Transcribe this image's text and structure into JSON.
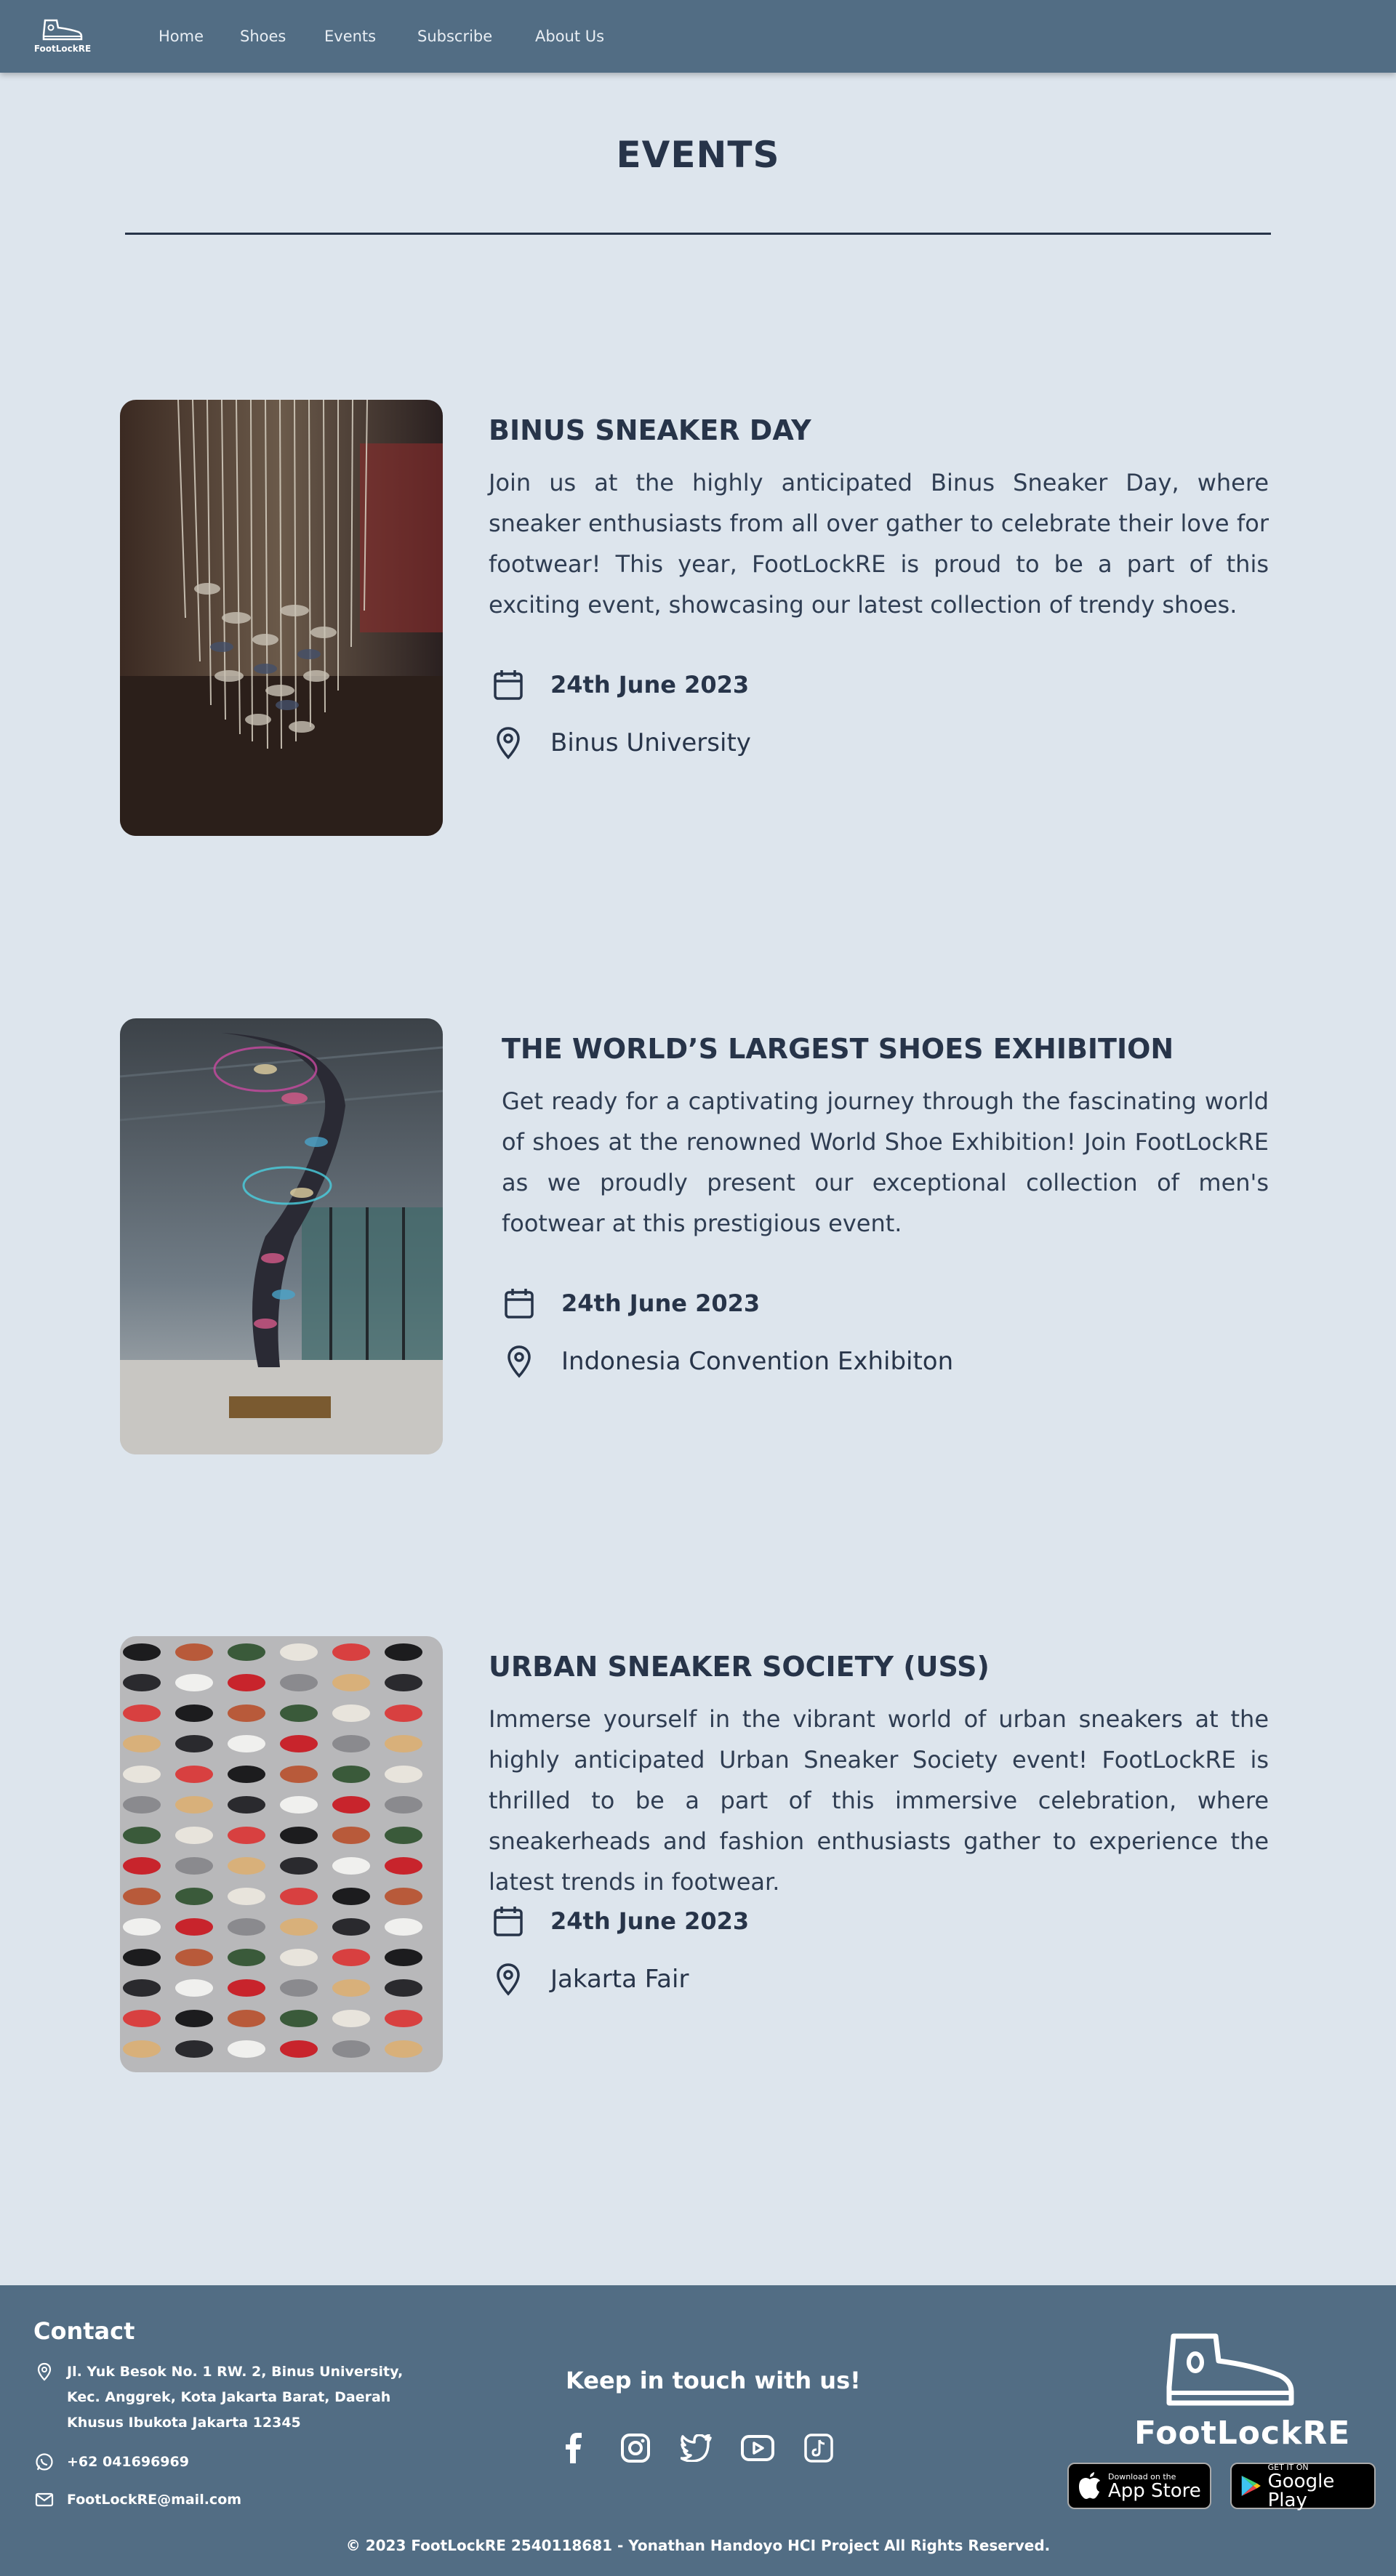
{
  "nav": {
    "logo_text": "FootLockRE",
    "links": [
      "Home",
      "Shoes",
      "Events",
      "Subscribe",
      "About Us"
    ]
  },
  "page": {
    "title": "EVENTS"
  },
  "events": [
    {
      "title": "BINUS SNEAKER DAY",
      "description": "Join us at the highly anticipated Binus Sneaker Day, where sneaker enthusiasts from all over gather to celebrate their love for footwear! This year, FootLockRE is proud to be a part of this exciting event, showcasing our latest collection of trendy shoes.",
      "date": "24th June 2023",
      "location": "Binus University"
    },
    {
      "title": "THE WORLD’S LARGEST SHOES EXHIBITION",
      "description": "Get ready for a captivating journey through the fascinating world of shoes at the renowned World Shoe Exhibition! Join FootLockRE as we proudly present our exceptional collection of men's footwear at this prestigious event.",
      "date": "24th June 2023",
      "location": "Indonesia Convention Exhibiton"
    },
    {
      "title": "URBAN SNEAKER SOCIETY (USS)",
      "description": "Immerse yourself in the vibrant world of urban sneakers at the highly anticipated Urban Sneaker Society event! FootLockRE is thrilled to be a part of this immersive celebration, where sneakerheads and fashion enthusiasts gather to experience the latest trends in footwear.",
      "date": "24th June 2023",
      "location": "Jakarta Fair"
    }
  ],
  "footer": {
    "contact_title": "Contact",
    "address_lines": [
      "Jl. Yuk Besok No. 1 RW. 2, Binus University,",
      "Kec. Anggrek, Kota Jakarta Barat, Daerah",
      "Khusus Ibukota Jakarta 12345"
    ],
    "phone": "+62 041696969",
    "email": "FootLockRE@mail.com",
    "keep_in_touch": "Keep in touch with us!",
    "social_icons": [
      "facebook-icon",
      "instagram-icon",
      "twitter-icon",
      "youtube-icon",
      "tiktok-icon"
    ],
    "brand_text": "FootLockRE",
    "app_store_small": "Download on the",
    "app_store_big": "App Store",
    "google_play_small": "GET IT ON",
    "google_play_big": "Google Play",
    "copyright": "© 2023 FootLockRE 2540118681 - Yonathan Handoyo HCI Project All Rights Reserved."
  },
  "colors": {
    "background": "#dde5ed",
    "navbar": "#526d84",
    "text_dark": "#273449",
    "footer": "#526d84"
  }
}
